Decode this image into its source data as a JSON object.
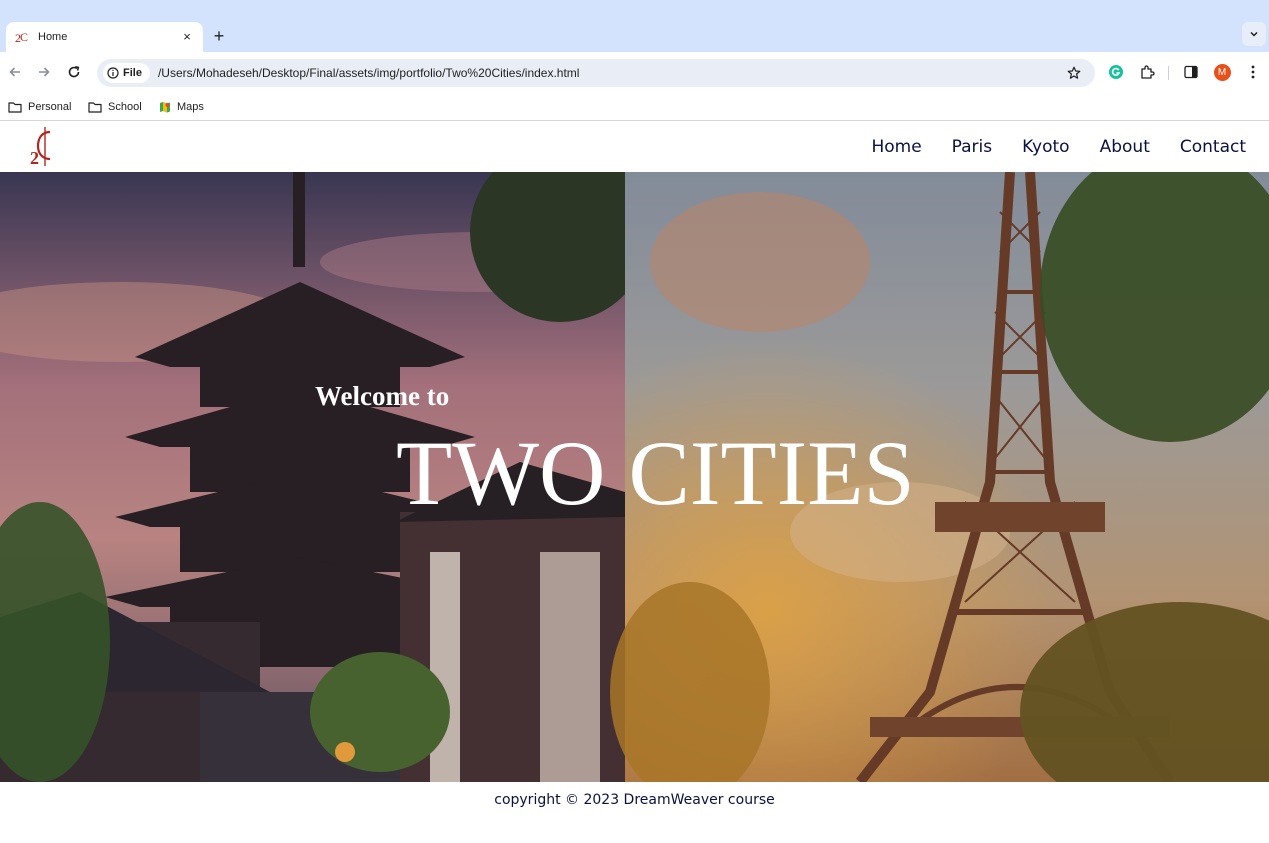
{
  "browser": {
    "tab": {
      "title": "Home",
      "close": "×"
    },
    "new_tab": "+",
    "omnibox": {
      "chip": "File",
      "url": "/Users/Mohadeseh/Desktop/Final/assets/img/portfolio/Two%20Cities/index.html"
    },
    "profile_initial": "M",
    "bookmarks": [
      {
        "label": "Personal",
        "icon": "folder-icon"
      },
      {
        "label": "School",
        "icon": "folder-icon"
      },
      {
        "label": "Maps",
        "icon": "maps-icon"
      }
    ]
  },
  "site": {
    "nav": [
      "Home",
      "Paris",
      "Kyoto",
      "About",
      "Contact"
    ],
    "hero": {
      "kicker": "Welcome to",
      "title": "TWO CITIES"
    },
    "footer": "copyright © 2023 DreamWeaver course"
  },
  "colors": {
    "nav_text": "#0b1240",
    "tabstrip": "#d3e3fd",
    "logo_red": "#b3261e"
  }
}
